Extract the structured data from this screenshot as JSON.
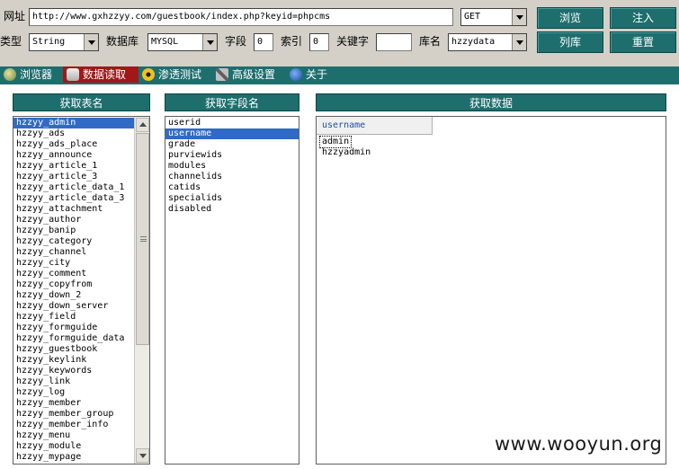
{
  "toolbar": {
    "url_label": "网址",
    "url_value": "http://www.gxhzzyy.com/guestbook/index.php?keyid=phpcms",
    "method_value": "GET",
    "type_label": "类型",
    "type_value": "String",
    "db_label": "数据库",
    "db_value": "MYSQL",
    "field_label": "字段",
    "field_value": "0",
    "index_label": "索引",
    "index_value": "0",
    "keyword_label": "关键字",
    "keyword_value": "",
    "dbname_label": "库名",
    "dbname_value": "hzzydata",
    "browse_button": "浏览",
    "inject_button": "注入",
    "listdb_button": "列库",
    "reset_button": "重置"
  },
  "tabs": [
    {
      "label": "浏览器",
      "icon": "globe-icon",
      "active": false
    },
    {
      "label": "数据读取",
      "icon": "database-icon",
      "active": true
    },
    {
      "label": "渗透测试",
      "icon": "radiation-icon",
      "active": false
    },
    {
      "label": "高级设置",
      "icon": "tools-icon",
      "active": false
    },
    {
      "label": "关于",
      "icon": "info-icon",
      "active": false
    }
  ],
  "panels": {
    "tables_header": "获取表名",
    "fields_header": "获取字段名",
    "data_header": "获取数据"
  },
  "tables": [
    "hzzyy_admin",
    "hzzyy_ads",
    "hzzyy_ads_place",
    "hzzyy_announce",
    "hzzyy_article_1",
    "hzzyy_article_3",
    "hzzyy_article_data_1",
    "hzzyy_article_data_3",
    "hzzyy_attachment",
    "hzzyy_author",
    "hzzyy_banip",
    "hzzyy_category",
    "hzzyy_channel",
    "hzzyy_city",
    "hzzyy_comment",
    "hzzyy_copyfrom",
    "hzzyy_down_2",
    "hzzyy_down_server",
    "hzzyy_field",
    "hzzyy_formguide",
    "hzzyy_formguide_data",
    "hzzyy_guestbook",
    "hzzyy_keylink",
    "hzzyy_keywords",
    "hzzyy_link",
    "hzzyy_log",
    "hzzyy_member",
    "hzzyy_member_group",
    "hzzyy_member_info",
    "hzzyy_menu",
    "hzzyy_module",
    "hzzyy_mypage"
  ],
  "selected_table": 0,
  "fields": [
    "userid",
    "username",
    "grade",
    "purviewids",
    "modules",
    "channelids",
    "catids",
    "specialids",
    "disabled"
  ],
  "selected_field": 1,
  "data_grid": {
    "column": "username",
    "rows": [
      "admin",
      "hzzyadmin"
    ]
  },
  "watermark": "www.wooyun.org"
}
